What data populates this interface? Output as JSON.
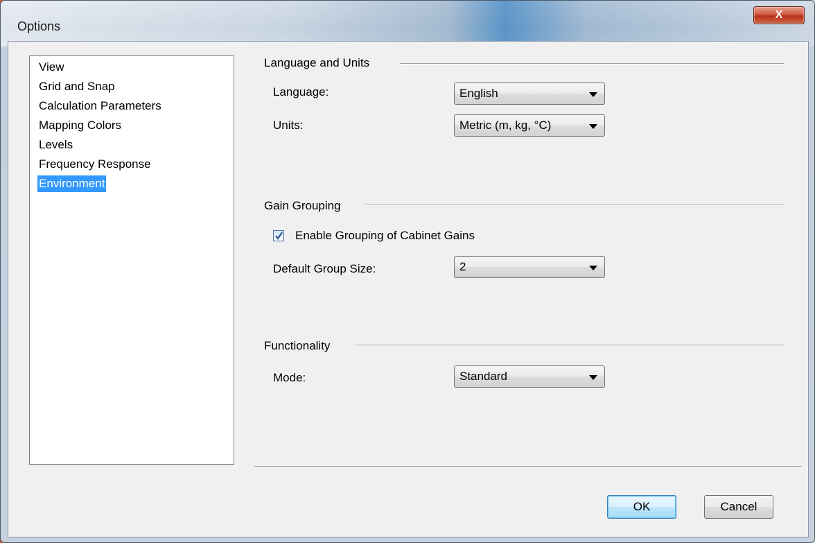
{
  "window": {
    "title": "Options",
    "close_label": "X"
  },
  "nav": {
    "items": [
      {
        "label": "View"
      },
      {
        "label": "Grid and Snap"
      },
      {
        "label": "Calculation Parameters"
      },
      {
        "label": "Mapping Colors"
      },
      {
        "label": "Levels"
      },
      {
        "label": "Frequency Response"
      },
      {
        "label": "Environment",
        "selected": true
      }
    ]
  },
  "language_units": {
    "title": "Language and Units",
    "language_label": "Language:",
    "language_value": "English",
    "units_label": "Units:",
    "units_value": "Metric (m, kg, °C)"
  },
  "gain_grouping": {
    "title": "Gain Grouping",
    "enable_label": "Enable Grouping of Cabinet Gains",
    "enable_checked": true,
    "group_size_label": "Default Group Size:",
    "group_size_value": "2"
  },
  "functionality": {
    "title": "Functionality",
    "mode_label": "Mode:",
    "mode_value": "Standard"
  },
  "buttons": {
    "ok": "OK",
    "cancel": "Cancel"
  },
  "colors": {
    "selection": "#3399ff",
    "dialog_bg": "#f0f0f0"
  }
}
